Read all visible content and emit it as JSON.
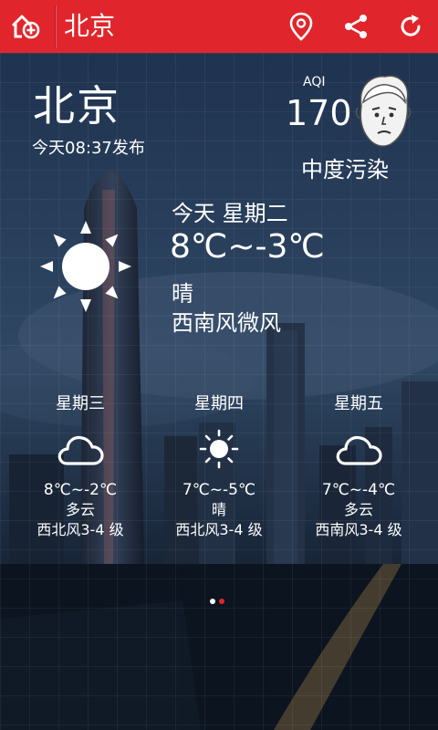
{
  "appbar": {
    "title": "北京",
    "icons": [
      "add-city-icon",
      "location-pin-icon",
      "share-icon",
      "refresh-icon"
    ]
  },
  "current": {
    "city": "北京",
    "published": "今天08:37发布",
    "aqi_label": "AQI",
    "aqi_value": "170",
    "aqi_level": "中度污染",
    "day_label": "今天 星期二",
    "temp_range": "8℃~-3℃",
    "condition": "晴",
    "wind": "西南风微风",
    "icon": "sun-icon"
  },
  "forecast": [
    {
      "day": "星期三",
      "icon": "cloud-icon",
      "temp": "8℃~-2℃",
      "condition": "多云",
      "wind": "西北风3-4 级"
    },
    {
      "day": "星期四",
      "icon": "sun-icon",
      "temp": "7℃~-5℃",
      "condition": "晴",
      "wind": "西北风3-4 级"
    },
    {
      "day": "星期五",
      "icon": "cloud-icon",
      "temp": "7℃~-4℃",
      "condition": "多云",
      "wind": "西南风3-4 级"
    }
  ],
  "pager": {
    "count": 2,
    "active_index": 1
  },
  "colors": {
    "accent": "#e0262c",
    "text": "#ffffff"
  }
}
